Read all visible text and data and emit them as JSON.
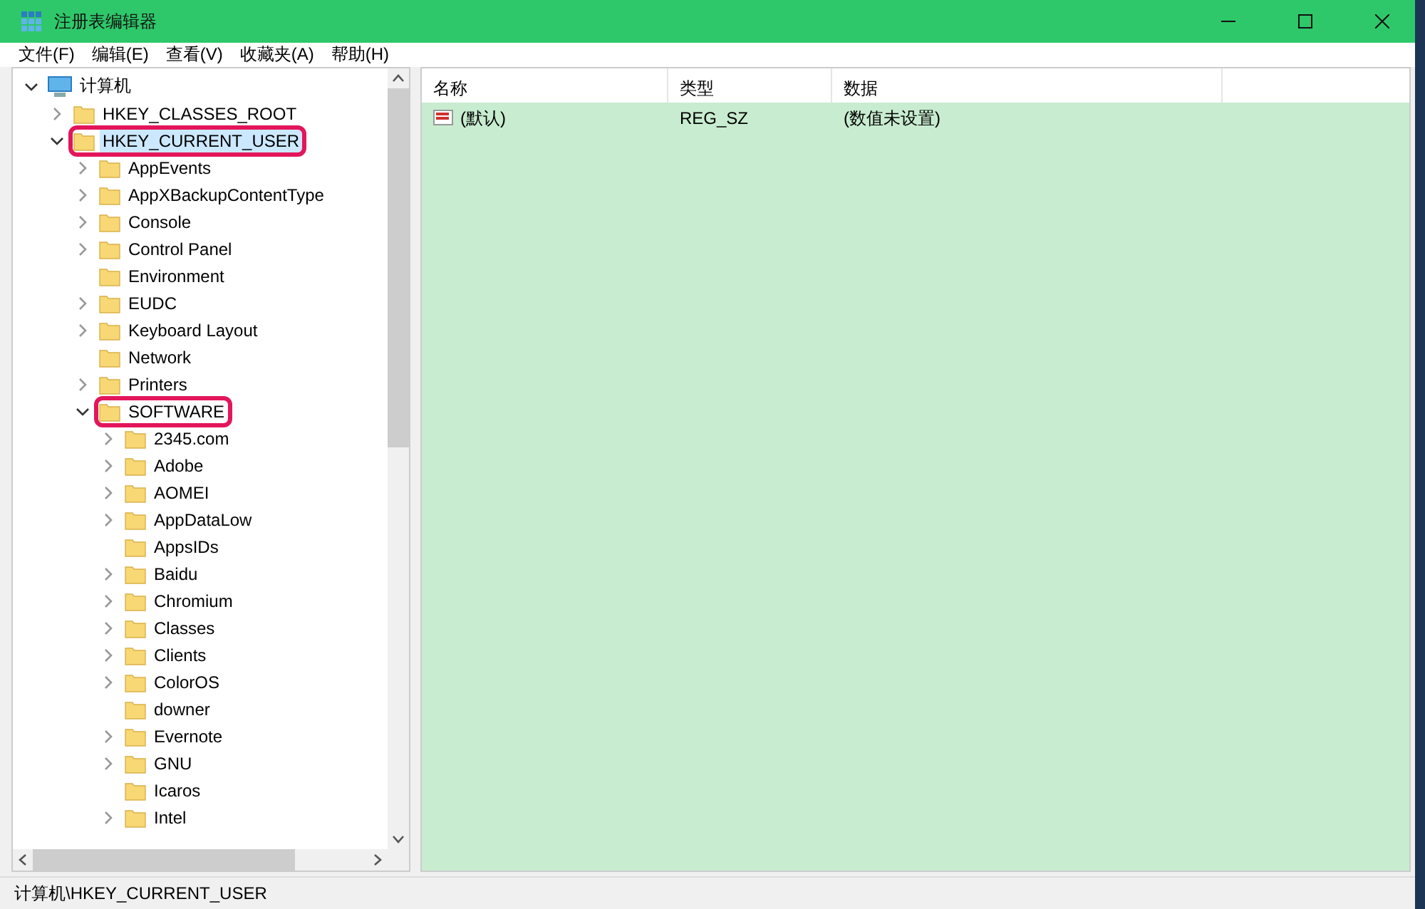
{
  "window": {
    "title": "注册表编辑器"
  },
  "menu": [
    "文件(F)",
    "编辑(E)",
    "查看(V)",
    "收藏夹(A)",
    "帮助(H)"
  ],
  "tree": [
    {
      "label": "计算机",
      "kind": "computer",
      "expanded": true,
      "selected": false,
      "highlighted": false,
      "children": [
        {
          "label": "HKEY_CLASSES_ROOT",
          "kind": "folder",
          "expanded": false,
          "selected": false,
          "highlighted": false
        },
        {
          "label": "HKEY_CURRENT_USER",
          "kind": "folder",
          "expanded": true,
          "selected": true,
          "highlighted": true,
          "children": [
            {
              "label": "AppEvents",
              "kind": "folder",
              "expanded": false,
              "selected": false,
              "highlighted": false
            },
            {
              "label": "AppXBackupContentType",
              "kind": "folder",
              "expanded": false,
              "selected": false,
              "highlighted": false
            },
            {
              "label": "Console",
              "kind": "folder",
              "expanded": false,
              "selected": false,
              "highlighted": false
            },
            {
              "label": "Control Panel",
              "kind": "folder",
              "expanded": false,
              "selected": false,
              "highlighted": false
            },
            {
              "label": "Environment",
              "kind": "folder",
              "selected": false,
              "highlighted": false
            },
            {
              "label": "EUDC",
              "kind": "folder",
              "expanded": false,
              "selected": false,
              "highlighted": false
            },
            {
              "label": "Keyboard Layout",
              "kind": "folder",
              "expanded": false,
              "selected": false,
              "highlighted": false
            },
            {
              "label": "Network",
              "kind": "folder",
              "selected": false,
              "highlighted": false
            },
            {
              "label": "Printers",
              "kind": "folder",
              "expanded": false,
              "selected": false,
              "highlighted": false
            },
            {
              "label": "SOFTWARE",
              "kind": "folder",
              "expanded": true,
              "selected": false,
              "highlighted": true,
              "children": [
                {
                  "label": "2345.com",
                  "kind": "folder",
                  "expanded": false,
                  "selected": false,
                  "highlighted": false
                },
                {
                  "label": "Adobe",
                  "kind": "folder",
                  "expanded": false,
                  "selected": false,
                  "highlighted": false
                },
                {
                  "label": "AOMEI",
                  "kind": "folder",
                  "expanded": false,
                  "selected": false,
                  "highlighted": false
                },
                {
                  "label": "AppDataLow",
                  "kind": "folder",
                  "expanded": false,
                  "selected": false,
                  "highlighted": false
                },
                {
                  "label": "AppsIDs",
                  "kind": "folder",
                  "selected": false,
                  "highlighted": false
                },
                {
                  "label": "Baidu",
                  "kind": "folder",
                  "expanded": false,
                  "selected": false,
                  "highlighted": false
                },
                {
                  "label": "Chromium",
                  "kind": "folder",
                  "expanded": false,
                  "selected": false,
                  "highlighted": false
                },
                {
                  "label": "Classes",
                  "kind": "folder",
                  "expanded": false,
                  "selected": false,
                  "highlighted": false
                },
                {
                  "label": "Clients",
                  "kind": "folder",
                  "expanded": false,
                  "selected": false,
                  "highlighted": false
                },
                {
                  "label": "ColorOS",
                  "kind": "folder",
                  "expanded": false,
                  "selected": false,
                  "highlighted": false
                },
                {
                  "label": "downer",
                  "kind": "folder",
                  "selected": false,
                  "highlighted": false
                },
                {
                  "label": "Evernote",
                  "kind": "folder",
                  "expanded": false,
                  "selected": false,
                  "highlighted": false
                },
                {
                  "label": "GNU",
                  "kind": "folder",
                  "expanded": false,
                  "selected": false,
                  "highlighted": false
                },
                {
                  "label": "Icaros",
                  "kind": "folder",
                  "selected": false,
                  "highlighted": false
                },
                {
                  "label": "Intel",
                  "kind": "folder",
                  "expanded": false,
                  "selected": false,
                  "highlighted": false
                }
              ]
            }
          ]
        }
      ]
    }
  ],
  "table": {
    "columns": [
      "名称",
      "类型",
      "数据"
    ],
    "rows": [
      {
        "name": "(默认)",
        "type": "REG_SZ",
        "data": "(数值未设置)"
      }
    ]
  },
  "status_bar": "计算机\\HKEY_CURRENT_USER"
}
